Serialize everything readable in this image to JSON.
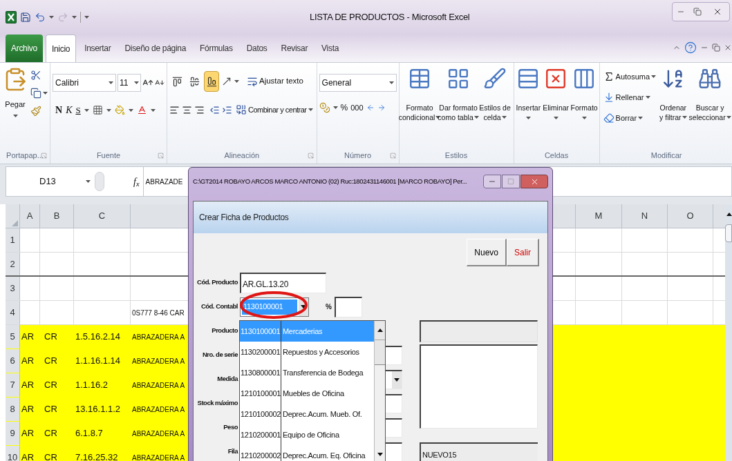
{
  "window": {
    "title": "LISTA DE PRODUCTOS - Microsoft Excel"
  },
  "tabs": [
    {
      "label": "Archivo",
      "kind": "file",
      "selected": false
    },
    {
      "label": "Inicio",
      "kind": "tab",
      "selected": true
    },
    {
      "label": "Insertar",
      "kind": "tab",
      "selected": false
    },
    {
      "label": "Diseño de página",
      "kind": "tab",
      "selected": false
    },
    {
      "label": "Fórmulas",
      "kind": "tab",
      "selected": false
    },
    {
      "label": "Datos",
      "kind": "tab",
      "selected": false
    },
    {
      "label": "Revisar",
      "kind": "tab",
      "selected": false
    },
    {
      "label": "Vista",
      "kind": "tab",
      "selected": false
    }
  ],
  "ribbon": {
    "clipboard": {
      "label": "Portapap...",
      "paste": "Pegar"
    },
    "font": {
      "label": "Fuente",
      "font_name": "Calibri",
      "font_size": "11",
      "bold": "N",
      "italic": "K",
      "underline": "S"
    },
    "alignment": {
      "label": "Alineación",
      "vertical_align": [
        {
          "selected": false
        },
        {
          "selected": false
        },
        {
          "selected": true
        }
      ],
      "wrap": "Ajustar texto",
      "merge": "Combinar y centrar"
    },
    "number": {
      "label": "Número",
      "format": "General",
      "percent": "%",
      "thousands": "000"
    },
    "styles": {
      "label": "Estilos",
      "buttons": [
        {
          "lines": [
            "Formato",
            "condicional"
          ]
        },
        {
          "lines": [
            "Dar formato",
            "como tabla"
          ]
        },
        {
          "lines": [
            "Estilos de",
            "celda"
          ]
        }
      ]
    },
    "cells": {
      "label": "Celdas",
      "buttons": [
        "Insertar",
        "Eliminar",
        "Formato"
      ]
    },
    "editing": {
      "label": "Modificar",
      "small": [
        "Autosuma",
        "Rellenar",
        "Borrar"
      ],
      "big": [
        {
          "lines": [
            "Ordenar",
            "y filtrar"
          ]
        },
        {
          "lines": [
            "Buscar y",
            "seleccionar"
          ]
        }
      ]
    }
  },
  "formula_bar": {
    "name_box": "D13",
    "fx": "f$_{x}$",
    "content": "ABRAZADE"
  },
  "sheet": {
    "columns_left": [
      "A",
      "B",
      "C"
    ],
    "columns_right": [
      "M",
      "N",
      "O"
    ],
    "rows": [
      {
        "number": "1",
        "highlighted": false,
        "cells": {}
      },
      {
        "number": "2",
        "highlighted": false,
        "cells": {}
      },
      {
        "number": "3",
        "highlighted": false,
        "cells": {}
      },
      {
        "number": "4",
        "highlighted": false,
        "cells": {
          "d": "0S777 8-46 CAR"
        }
      },
      {
        "number": "5",
        "highlighted": true,
        "cells": {
          "a": "AR",
          "b": "CR",
          "c": "1.5.16.2.14",
          "d": "ABRAZADERA A"
        }
      },
      {
        "number": "6",
        "highlighted": true,
        "cells": {
          "a": "AR",
          "b": "CR",
          "c": "1.1.16.1.14",
          "d": "ABRAZADERA A"
        }
      },
      {
        "number": "7",
        "highlighted": true,
        "cells": {
          "a": "AR",
          "b": "CR",
          "c": "1.1.16.2",
          "d": "ABRAZADERA A"
        }
      },
      {
        "number": "8",
        "highlighted": true,
        "cells": {
          "a": "AR",
          "b": "CR",
          "c": "13.16.1.1.2",
          "d": "ABRAZADERA A"
        }
      },
      {
        "number": "9",
        "highlighted": true,
        "cells": {
          "a": "AR",
          "b": "CR",
          "c": "6.1.8.7",
          "d": "ABRAZADERA A"
        }
      },
      {
        "number": "10",
        "highlighted": true,
        "cells": {
          "a": "AR",
          "b": "CR",
          "c": "7.16.25.32",
          "d": "ABRAZADERA A"
        }
      }
    ]
  },
  "dialog": {
    "title": "C:\\GT2014   ROBAYO ARCOS MARCO ANTONIO (02) Ruc:1802431146001 [MARCO ROBAYO] Per...",
    "form_title": "Crear Ficha de Productos",
    "buttons": [
      {
        "label": "Nuevo",
        "kind": "normal"
      },
      {
        "label": "Salir",
        "kind": "exit"
      }
    ],
    "code_field": {
      "label": "Cód. Producto",
      "value": "AR.GL.13.20"
    },
    "account_field": {
      "label": "Cód. Contabl",
      "value": "1130100001",
      "tax_label": "%"
    },
    "fields": [
      {
        "label": "Producto",
        "kind": "label"
      },
      {
        "label": "Nro. de serie",
        "kind": "text"
      },
      {
        "label": "Medida",
        "kind": "combo"
      },
      {
        "label": "Stock máximo",
        "kind": "text"
      },
      {
        "label": "Peso",
        "kind": "text"
      },
      {
        "label": "Fila",
        "kind": "text"
      }
    ],
    "side_boxes": [
      {
        "kind": "readonly"
      },
      {
        "kind": "memo"
      },
      {
        "kind": "text",
        "value": "NUEVO15"
      }
    ],
    "account_list": [
      {
        "code": "1130100001",
        "name": "Mercaderias",
        "selected": true
      },
      {
        "code": "1130200001",
        "name": "Repuestos y Accesorios",
        "selected": false
      },
      {
        "code": "1130800001",
        "name": "Transferencia de Bodega",
        "selected": false
      },
      {
        "code": "1210100001",
        "name": "Muebles de Oficina",
        "selected": false
      },
      {
        "code": "1210100002",
        "name": "Deprec.Acum. Mueb. Of.",
        "selected": false
      },
      {
        "code": "1210200001",
        "name": "Equipo de Oficina",
        "selected": false
      },
      {
        "code": "1210200002",
        "name": "Deprec.Acum. Eq. Oficina",
        "selected": false
      }
    ]
  }
}
